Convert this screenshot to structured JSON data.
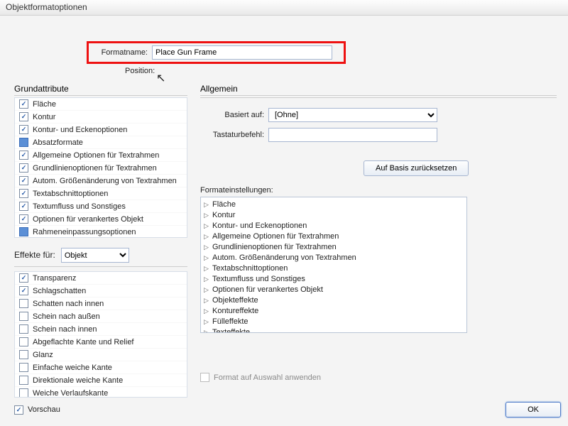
{
  "window": {
    "title": "Objektformatoptionen"
  },
  "formatname": {
    "label": "Formatname:",
    "value": "Place Gun Frame"
  },
  "position": {
    "label": "Position:"
  },
  "left": {
    "basic_title": "Grundattribute",
    "attributes": [
      {
        "label": "Fläche",
        "state": "checked"
      },
      {
        "label": "Kontur",
        "state": "checked"
      },
      {
        "label": "Kontur- und Eckenoptionen",
        "state": "checked"
      },
      {
        "label": "Absatzformate",
        "state": "mixed"
      },
      {
        "label": "Allgemeine Optionen für Textrahmen",
        "state": "checked"
      },
      {
        "label": "Grundlinienoptionen für Textrahmen",
        "state": "checked"
      },
      {
        "label": "Autom. Größenänderung von Textrahmen",
        "state": "checked"
      },
      {
        "label": "Textabschnittoptionen",
        "state": "checked"
      },
      {
        "label": "Textumfluss und Sonstiges",
        "state": "checked"
      },
      {
        "label": "Optionen für verankertes Objekt",
        "state": "checked"
      },
      {
        "label": "Rahmeneinpassungsoptionen",
        "state": "mixed"
      }
    ],
    "effects_label": "Effekte für:",
    "effects_target": "Objekt",
    "effects": [
      {
        "label": "Transparenz",
        "state": "checked"
      },
      {
        "label": "Schlagschatten",
        "state": "checked"
      },
      {
        "label": "Schatten nach innen",
        "state": "unchecked"
      },
      {
        "label": "Schein nach außen",
        "state": "unchecked"
      },
      {
        "label": "Schein nach innen",
        "state": "unchecked"
      },
      {
        "label": "Abgeflachte Kante und Relief",
        "state": "unchecked"
      },
      {
        "label": "Glanz",
        "state": "unchecked"
      },
      {
        "label": "Einfache weiche Kante",
        "state": "unchecked"
      },
      {
        "label": "Direktionale weiche Kante",
        "state": "unchecked"
      },
      {
        "label": "Weiche Verlaufskante",
        "state": "unchecked"
      }
    ]
  },
  "right": {
    "general_title": "Allgemein",
    "based_on_label": "Basiert auf:",
    "based_on_value": "[Ohne]",
    "shortcut_label": "Tastaturbefehl:",
    "shortcut_value": "",
    "reset_label": "Auf Basis zurücksetzen",
    "format_settings_label": "Formateinstellungen:",
    "tree": [
      "Fläche",
      "Kontur",
      "Kontur- und Eckenoptionen",
      "Allgemeine Optionen für Textrahmen",
      "Grundlinienoptionen für Textrahmen",
      "Autom. Größenänderung von Textrahmen",
      "Textabschnittoptionen",
      "Textumfluss und Sonstiges",
      "Optionen für verankertes Objekt",
      "Objekteffekte",
      "Kontureffekte",
      "Fülleffekte",
      "Texteffekte"
    ],
    "apply_label": "Format auf Auswahl anwenden"
  },
  "bottom": {
    "preview_label": "Vorschau",
    "ok": "OK"
  }
}
